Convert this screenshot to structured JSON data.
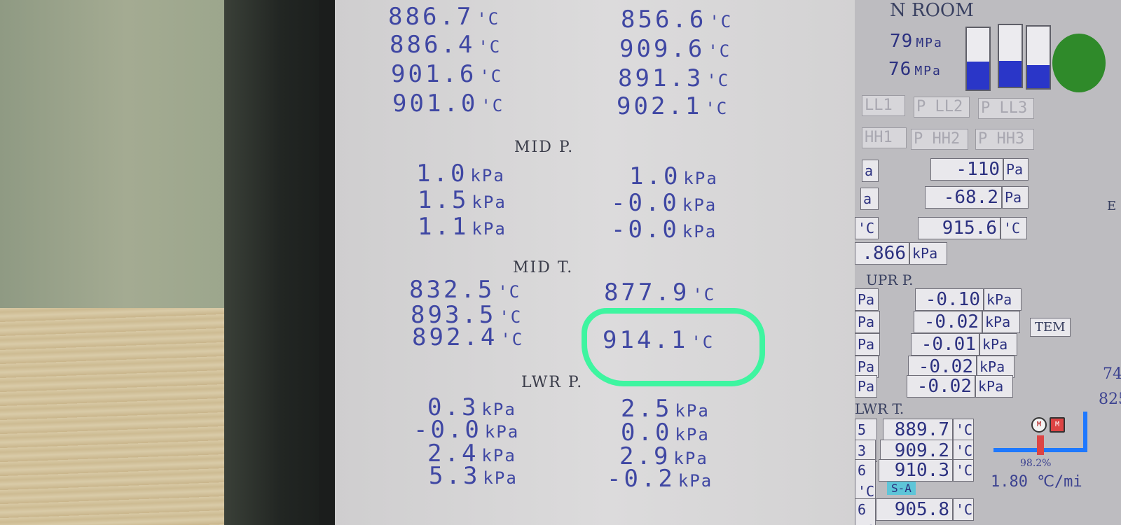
{
  "left_panel": {
    "upper_rows": [
      {
        "left": "886.7",
        "left_unit": "'C",
        "right": "856.6",
        "right_unit": "'C"
      },
      {
        "left": "886.4",
        "left_unit": "'C",
        "right": "909.6",
        "right_unit": "'C"
      },
      {
        "left": "901.6",
        "left_unit": "'C",
        "right": "891.3",
        "right_unit": "'C"
      },
      {
        "left": "901.0",
        "left_unit": "'C",
        "right": "902.1",
        "right_unit": "'C"
      }
    ],
    "mid_p_title": "MID P.",
    "mid_p_rows": [
      {
        "left": "1.0",
        "left_unit": "kPa",
        "right": "1.0",
        "right_unit": "kPa"
      },
      {
        "left": "1.5",
        "left_unit": "kPa",
        "right": "-0.0",
        "right_unit": "kPa"
      },
      {
        "left": "1.1",
        "left_unit": "kPa",
        "right": "-0.0",
        "right_unit": "kPa"
      }
    ],
    "mid_t_title": "MID T.",
    "mid_t_rows": [
      {
        "left": "832.5",
        "left_unit": "'C",
        "right": "877.9",
        "right_unit": "'C"
      },
      {
        "left": "893.5",
        "left_unit": "'C",
        "right": "",
        "right_unit": ""
      },
      {
        "left": "892.4",
        "left_unit": "'C",
        "right": "914.1",
        "right_unit": "'C"
      }
    ],
    "lwr_p_title": "LWR P.",
    "lwr_p_rows": [
      {
        "left": "0.3",
        "left_unit": "kPa",
        "right": "2.5",
        "right_unit": "kPa"
      },
      {
        "left": "-0.0",
        "left_unit": "kPa",
        "right": "0.0",
        "right_unit": "kPa"
      },
      {
        "left": "2.4",
        "left_unit": "kPa",
        "right": "2.9",
        "right_unit": "kPa"
      },
      {
        "left": "5.3",
        "left_unit": "kPa",
        "right": "-0.2",
        "right_unit": "kPa"
      }
    ]
  },
  "right_panel": {
    "room_title": "N ROOM",
    "pressure_1": "79",
    "pressure_2": "76",
    "pressure_unit": "MPa",
    "tank_levels": [
      0.45,
      0.42,
      0.38
    ],
    "flags_row1": [
      "LL1",
      "P LL2",
      "P LL3"
    ],
    "flags_row2": [
      "HH1",
      "P HH2",
      "P HH3"
    ],
    "draft_1": {
      "value": "-110",
      "unit": "Pa"
    },
    "draft_2": {
      "value": "-68.2",
      "unit": "Pa"
    },
    "temp_1": {
      "value": "915.6",
      "unit": "'C"
    },
    "pressure_866": {
      "value": ".866",
      "unit": "kPa"
    },
    "partial_units": [
      "a",
      "a",
      "'C"
    ],
    "upr_p_title": "UPR P.",
    "upr_p_rows": [
      {
        "value": "-0.10",
        "unit": "kPa",
        "left_unit": "Pa"
      },
      {
        "value": "-0.02",
        "unit": "kPa",
        "left_unit": "Pa"
      },
      {
        "value": "-0.01",
        "unit": "kPa",
        "left_unit": "Pa"
      },
      {
        "value": "-0.02",
        "unit": "kPa",
        "left_unit": "Pa"
      },
      {
        "value": "-0.02",
        "unit": "kPa",
        "left_unit": "Pa"
      }
    ],
    "tem_badge": "TEM",
    "lwr_t_title": "LWR T.",
    "lwr_t_rows": [
      {
        "value": "889.7",
        "unit": "'C",
        "left_unit": "5 'C"
      },
      {
        "value": "909.2",
        "unit": "'C",
        "left_unit": "3 'C"
      },
      {
        "value": "910.3",
        "unit": "'C",
        "left_unit": "6 'C"
      }
    ],
    "sa_badge": "S-A",
    "bottom_row": {
      "value": "905.8",
      "unit": "'C",
      "left_unit": "6 'C"
    },
    "edge_values": [
      "74",
      "825"
    ],
    "percent": "98.2%",
    "rate": "1.80 ℃/mi",
    "side_letter": "E",
    "valve_label": "M"
  }
}
